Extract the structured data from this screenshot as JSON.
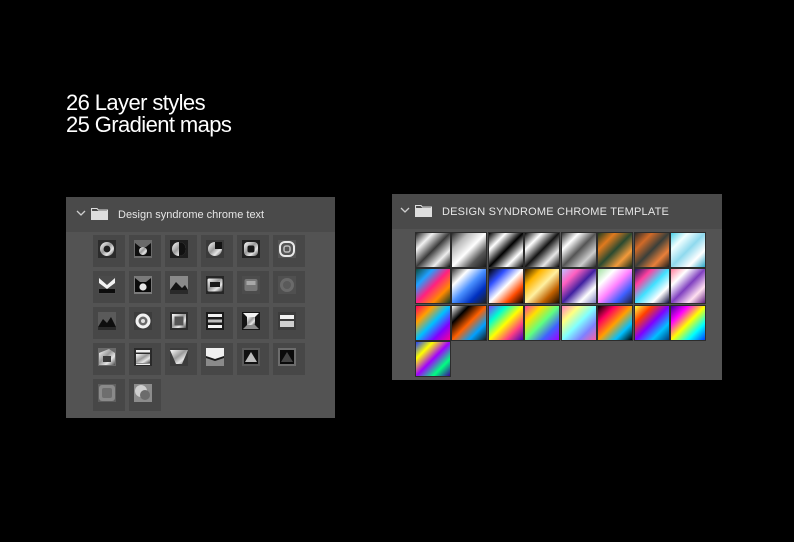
{
  "headline": {
    "line1": "26 Layer styles",
    "line2": "25 Gradient maps"
  },
  "left_panel": {
    "title": "Design syndrome chrome text",
    "icons": {
      "expand": "chevron-down-icon",
      "folder": "folder-icon"
    },
    "styles": [
      {
        "shape": "ring"
      },
      {
        "shape": "cat"
      },
      {
        "shape": "ring-dark"
      },
      {
        "shape": "half-circle"
      },
      {
        "shape": "rounded-square"
      },
      {
        "shape": "spiral"
      },
      {
        "shape": "bowtie"
      },
      {
        "shape": "cat-dark"
      },
      {
        "shape": "mountain"
      },
      {
        "shape": "window"
      },
      {
        "shape": "soft-square"
      },
      {
        "shape": "dim-square"
      },
      {
        "shape": "mountain-dark"
      },
      {
        "shape": "target"
      },
      {
        "shape": "framed-square"
      },
      {
        "shape": "bars"
      },
      {
        "shape": "bevel-square"
      },
      {
        "shape": "double-bar"
      },
      {
        "shape": "angled"
      },
      {
        "shape": "banded"
      },
      {
        "shape": "funnel"
      },
      {
        "shape": "split"
      },
      {
        "shape": "pyramid"
      },
      {
        "shape": "pyramid-dark"
      },
      {
        "shape": "blur"
      },
      {
        "shape": "blur-light"
      }
    ]
  },
  "right_panel": {
    "title": "DESIGN SYNDROME CHROME TEMPLATE",
    "icons": {
      "expand": "chevron-down-icon",
      "folder": "folder-icon"
    },
    "gradients": [
      [
        "#222222",
        "#f2f2f2",
        "#3a3a3a",
        "#eeeeee",
        "#111111"
      ],
      [
        "#2a2a2a",
        "#bbbbbb",
        "#ffffff",
        "#555555",
        "#1a1a1a"
      ],
      [
        "#000000",
        "#ffffff",
        "#000000",
        "#ffffff",
        "#000000"
      ],
      [
        "#0a0a0a",
        "#ffffff",
        "#141414",
        "#e6e6e6",
        "#050505"
      ],
      [
        "#333333",
        "#ffffff",
        "#555555",
        "#cccccc",
        "#222222"
      ],
      [
        "#1d3b22",
        "#e07a1e",
        "#2a4a30",
        "#f39a3a",
        "#172d1a"
      ],
      [
        "#2b2b2b",
        "#d06a28",
        "#3a3f3a",
        "#e9803a",
        "#1e1e1e"
      ],
      [
        "#4ad0e8",
        "#f0ffff",
        "#8fd9ee",
        "#ffffff",
        "#2aa6c8"
      ],
      [
        "#0e4a3a",
        "#20a0ff",
        "#ff2080",
        "#ff8a00",
        "#103a2a"
      ],
      [
        "#3a3a3a",
        "#ffffff",
        "#4a90ff",
        "#0030c0",
        "#202020"
      ],
      [
        "#000000",
        "#3050ff",
        "#ffffff",
        "#ff4a00",
        "#000000"
      ],
      [
        "#2a1400",
        "#ffb400",
        "#fff0a0",
        "#c06000",
        "#1a0c00"
      ],
      [
        "#c0c0ff",
        "#ff60c0",
        "#4020a0",
        "#ffffff",
        "#8080c0"
      ],
      [
        "#a0e0a0",
        "#ffffff",
        "#ff80ff",
        "#4060ff",
        "#202040"
      ],
      [
        "#1a1a60",
        "#ff40a0",
        "#40e0ff",
        "#ffffff",
        "#101040"
      ],
      [
        "#ff80a0",
        "#ffffff",
        "#8040c0",
        "#ffe0f0",
        "#602080"
      ],
      [
        "#ff0060",
        "#ffa000",
        "#00c0ff",
        "#8000ff",
        "#ff0090"
      ],
      [
        "#ffffff",
        "#000000",
        "#ff6000",
        "#00a0ff",
        "#1a1a1a"
      ],
      [
        "#8040ff",
        "#00ffd0",
        "#ffff00",
        "#ff4080",
        "#4000c0"
      ],
      [
        "#ff40a0",
        "#ffe000",
        "#60ff80",
        "#4060ff",
        "#a000ff"
      ],
      [
        "#ff80c0",
        "#ffff80",
        "#80ffff",
        "#8080ff",
        "#ff60a0"
      ],
      [
        "#000000",
        "#ff0060",
        "#ffa000",
        "#00c0ff",
        "#000000"
      ],
      [
        "#ffff40",
        "#ff4000",
        "#8000ff",
        "#00c0ff",
        "#004080"
      ],
      [
        "#4000a0",
        "#ff00ff",
        "#ffff00",
        "#00ffff",
        "#0040ff"
      ],
      [
        "#2040ff",
        "#ffff00",
        "#a000ff",
        "#00ff80",
        "#4000a0"
      ]
    ]
  }
}
